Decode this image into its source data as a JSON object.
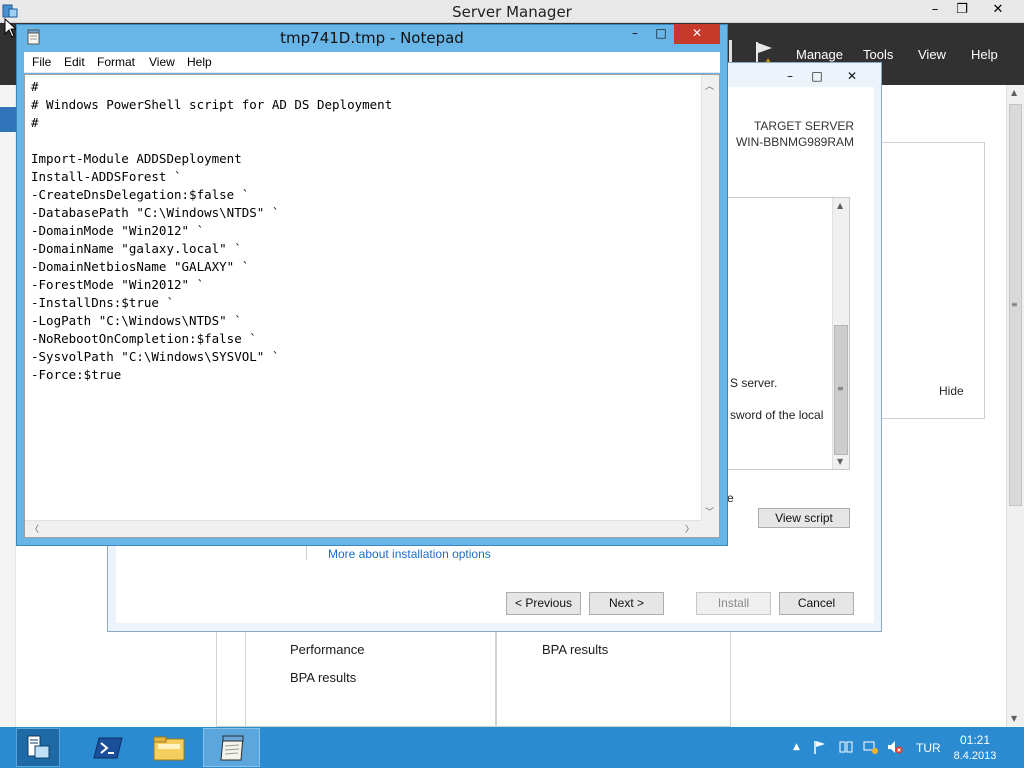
{
  "server_manager": {
    "title": "Server Manager",
    "controls": {
      "minimize": "–",
      "restore": "❐",
      "close": "✕"
    },
    "menu": [
      "Manage",
      "Tools",
      "View",
      "Help"
    ],
    "tiles": {
      "left": [
        "Performance",
        "BPA results"
      ],
      "right": [
        "BPA results"
      ]
    },
    "hide_label": "Hide"
  },
  "wizard": {
    "controls": {
      "minimize": "–",
      "maximize": "□",
      "close": "✕"
    },
    "target_server_label": "TARGET SERVER",
    "target_server_name": "WIN-BBNMG989RAM",
    "list_fragments": [
      "S server.",
      "sword of the local"
    ],
    "e_fragment": "e",
    "view_script": "View script",
    "link": "More about installation options",
    "buttons": {
      "previous": "< Previous",
      "next": "Next >",
      "install": "Install",
      "cancel": "Cancel"
    }
  },
  "notepad": {
    "title": "tmp741D.tmp - Notepad",
    "controls": {
      "minimize": "–",
      "maximize": "□",
      "close": "✕"
    },
    "menu": [
      "File",
      "Edit",
      "Format",
      "View",
      "Help"
    ],
    "content": "#\n# Windows PowerShell script for AD DS Deployment\n#\n\nImport-Module ADDSDeployment\nInstall-ADDSForest `\n-CreateDnsDelegation:$false `\n-DatabasePath \"C:\\Windows\\NTDS\" `\n-DomainMode \"Win2012\" `\n-DomainName \"galaxy.local\" `\n-DomainNetbiosName \"GALAXY\" `\n-ForestMode \"Win2012\" `\n-InstallDns:$true `\n-LogPath \"C:\\Windows\\NTDS\" `\n-NoRebootOnCompletion:$false `\n-SysvolPath \"C:\\Windows\\SYSVOL\" `\n-Force:$true"
  },
  "taskbar": {
    "language": "TUR",
    "time": "01:21",
    "date": "8.4.2013"
  },
  "colors": {
    "taskbar": "#2b8bd0",
    "notepad_frame": "#68b5e8",
    "close_red": "#c7392b",
    "header_dark": "#313131",
    "link_blue": "#1e6ec4"
  }
}
